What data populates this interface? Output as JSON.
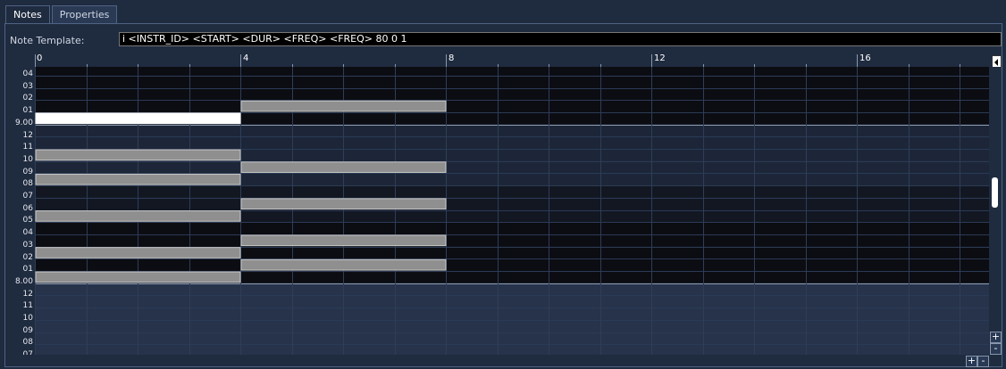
{
  "tabs": [
    {
      "label": "Notes",
      "active": true
    },
    {
      "label": "Properties",
      "active": false
    }
  ],
  "template": {
    "label": "Note Template:",
    "value": "i <INSTR_ID> <START> <DUR> <FREQ> <FREQ> 80 0 1"
  },
  "timeline": {
    "labels": [
      "0",
      "4",
      "8",
      "12",
      "16"
    ]
  },
  "pitch_labels": [
    "04",
    "03",
    "02",
    "01",
    "9.00",
    "12",
    "11",
    "10",
    "09",
    "08",
    "07",
    "06",
    "05",
    "04",
    "03",
    "02",
    "01",
    "8.00",
    "12",
    "11",
    "10",
    "09",
    "08",
    "07"
  ],
  "notes": [
    {
      "pitch": "9.01",
      "start": 4,
      "duration": 4,
      "selected": false
    },
    {
      "pitch": "9.00",
      "start": 0,
      "duration": 4,
      "selected": true
    },
    {
      "pitch": "8.10",
      "start": 0,
      "duration": 4,
      "selected": false
    },
    {
      "pitch": "8.09",
      "start": 4,
      "duration": 4,
      "selected": false
    },
    {
      "pitch": "8.08",
      "start": 0,
      "duration": 4,
      "selected": false
    },
    {
      "pitch": "8.06",
      "start": 4,
      "duration": 4,
      "selected": false
    },
    {
      "pitch": "8.05",
      "start": 0,
      "duration": 4,
      "selected": false
    },
    {
      "pitch": "8.03",
      "start": 4,
      "duration": 4,
      "selected": false
    },
    {
      "pitch": "8.02",
      "start": 0,
      "duration": 4,
      "selected": false
    },
    {
      "pitch": "8.01",
      "start": 4,
      "duration": 4,
      "selected": false
    },
    {
      "pitch": "8.00",
      "start": 0,
      "duration": 4,
      "selected": false
    }
  ],
  "buttons": {
    "zoom_in_vertical": "+",
    "zoom_out_vertical": "-",
    "zoom_in_horizontal": "+",
    "zoom_out_horizontal": "-"
  },
  "colors": {
    "background": "#1f2b3f",
    "grid_dark": "#0b0b10",
    "grid_light": "#26334b",
    "note_fill": "#8f8f8f",
    "note_selected": "#ffffff",
    "marker": "#22cc22"
  }
}
